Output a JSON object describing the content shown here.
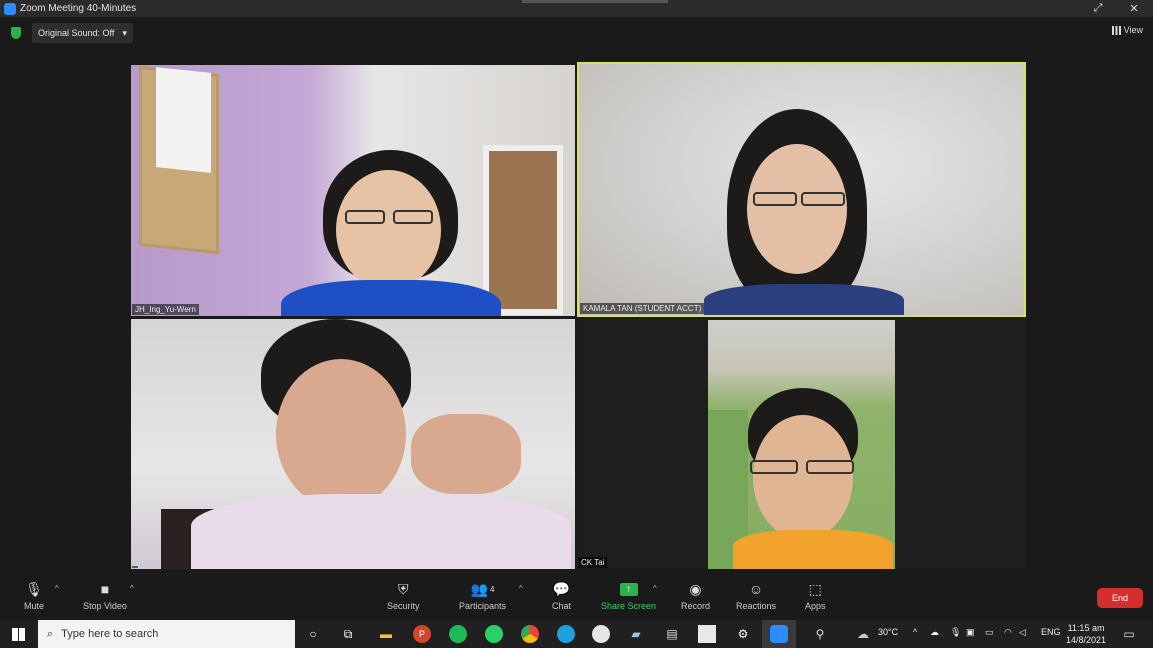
{
  "window": {
    "title": "Zoom Meeting 40-Minutes",
    "restore_icon": "restore-icon",
    "close_glyph": "✕"
  },
  "topbar": {
    "sound_label": "Original Sound: Off",
    "sound_caret": "▾",
    "view_label": "View"
  },
  "participants": [
    {
      "name": "JH_Ing_Yu-Wern"
    },
    {
      "name": "KAMALA TAN (STUDENT ACCT)"
    },
    {
      "name": ""
    },
    {
      "name": "CK Tai"
    }
  ],
  "toolbar": {
    "mute": "Mute",
    "stop_video": "Stop Video",
    "security": "Security",
    "participants": "Participants",
    "participants_count": "4",
    "chat": "Chat",
    "share_screen": "Share Screen",
    "record": "Record",
    "reactions": "Reactions",
    "apps": "Apps",
    "end": "End",
    "caret": "^"
  },
  "taskbar": {
    "search_placeholder": "Type here to search",
    "weather": "30°C",
    "lang": "ENG",
    "time": "11:15 am",
    "date": "14/8/2021"
  },
  "colors": {
    "active_speaker": "#d9e35a",
    "end_button": "#d42e2e",
    "share_green": "#2bb24c"
  }
}
